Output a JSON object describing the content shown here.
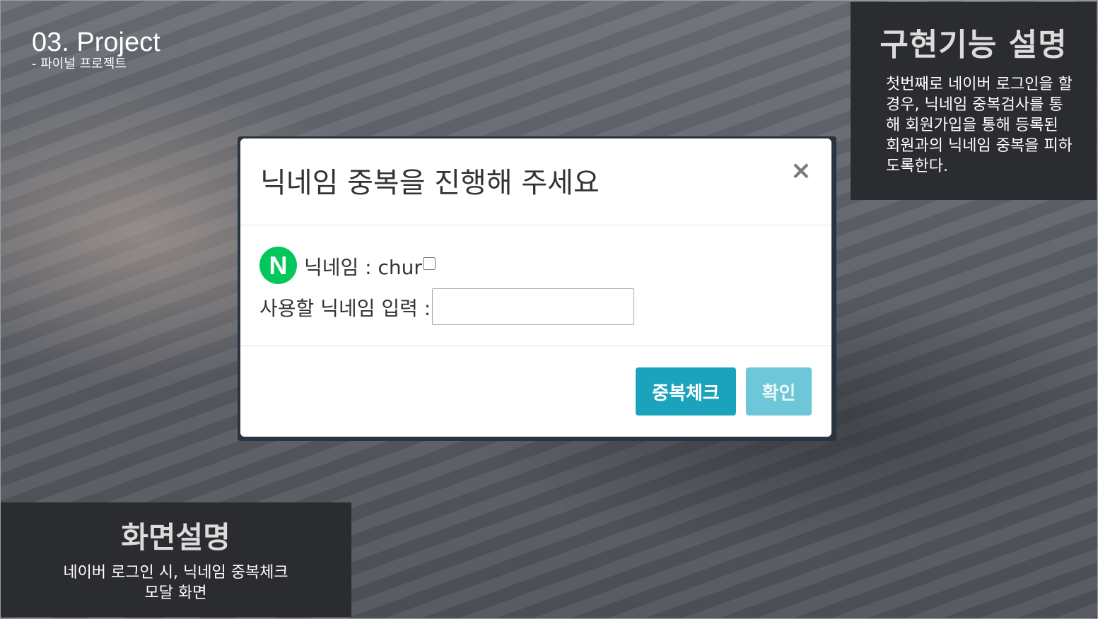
{
  "slide": {
    "title": "03. Project",
    "subtitle": "- 파이널 프로젝트"
  },
  "feature_panel": {
    "title": "구현기능 설명",
    "body": "첫번째로 네이버 로그인을 할 경우, 닉네임 중복검사를 통해 회원가입을 통해 등록된 회원과의 닉네임 중복을 피하도록한다."
  },
  "screen_panel": {
    "title": "화면설명",
    "body_line1": "네이버 로그인 시, 닉네임 중복체크",
    "body_line2": "모달 화면"
  },
  "modal": {
    "title": "닉네임 중복을 진행해 주세요",
    "close_symbol": "×",
    "logo_letter": "N",
    "nickname_label": "닉네임 : chur",
    "nickname_checked": false,
    "input_label": "사용할 닉네임 입력 :",
    "input_value": "",
    "input_placeholder": "",
    "check_button": "중복체크",
    "confirm_button": "확인"
  },
  "colors": {
    "naver_green": "#03c75a",
    "check_button": "#1ba3bd",
    "confirm_button": "#6ec7d8",
    "panel_bg": "#2b2c2f"
  }
}
